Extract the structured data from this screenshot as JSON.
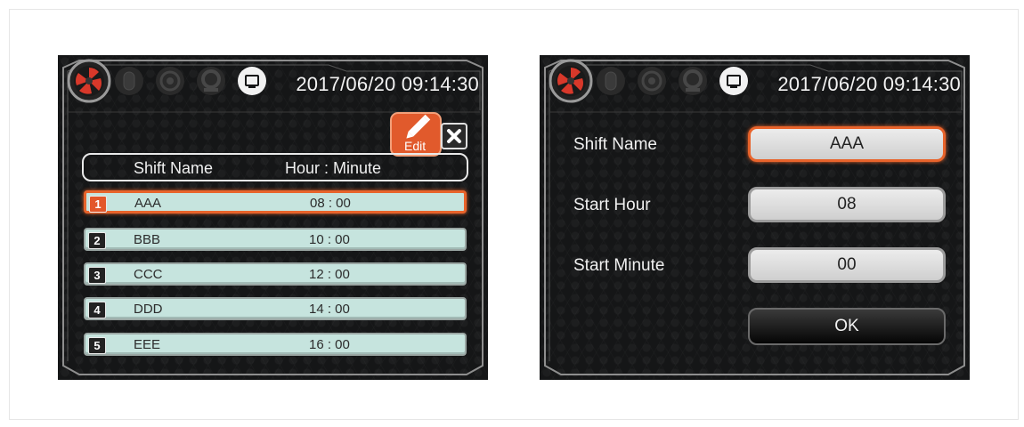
{
  "screens": [
    {
      "datetime": "2017/06/20 09:14:30",
      "edit_label": "Edit",
      "header": {
        "col_name": "Shift Name",
        "col_time": "Hour : Minute"
      },
      "rows": [
        {
          "num": "1",
          "name": "AAA",
          "time": "08 : 00",
          "selected": true
        },
        {
          "num": "2",
          "name": "BBB",
          "time": "10 : 00",
          "selected": false
        },
        {
          "num": "3",
          "name": "CCC",
          "time": "12 : 00",
          "selected": false
        },
        {
          "num": "4",
          "name": "DDD",
          "time": "14 : 00",
          "selected": false
        },
        {
          "num": "5",
          "name": "EEE",
          "time": "16 : 00",
          "selected": false
        }
      ]
    },
    {
      "datetime": "2017/06/20 09:14:30",
      "form": {
        "shift_name_label": "Shift Name",
        "shift_name_value": "AAA",
        "start_hour_label": "Start Hour",
        "start_hour_value": "08",
        "start_minute_label": "Start Minute",
        "start_minute_value": "00",
        "ok_label": "OK"
      }
    }
  ],
  "colors": {
    "accent": "#e8632b",
    "row_fill": "#c6e4de",
    "panel_bg": "#151617"
  },
  "icons": [
    "fan-icon",
    "mouse-icon",
    "disc-icon",
    "gear-icon",
    "screen-icon",
    "edit-icon",
    "close-icon"
  ]
}
